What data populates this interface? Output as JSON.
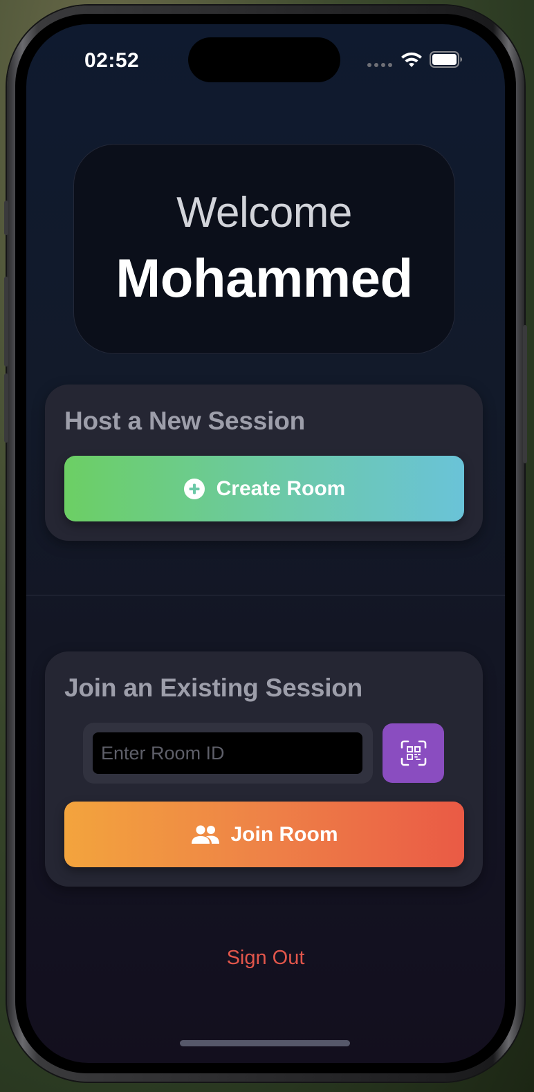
{
  "status_bar": {
    "time": "02:52",
    "icons": [
      "signal-dots-icon",
      "wifi-icon",
      "battery-icon"
    ]
  },
  "welcome": {
    "greeting": "Welcome",
    "name": "Mohammed"
  },
  "host_section": {
    "title": "Host a New Session",
    "create_button_label": "Create Room",
    "create_button_icon": "plus-circle-icon"
  },
  "join_section": {
    "title": "Join an Existing Session",
    "room_id_placeholder": "Enter Room ID",
    "room_id_value": "",
    "qr_button_icon": "qr-scan-icon",
    "join_button_label": "Join Room",
    "join_button_icon": "people-icon"
  },
  "sign_out_label": "Sign Out",
  "colors": {
    "create_gradient": [
      "#6ccf64",
      "#6ac3d8"
    ],
    "join_gradient": [
      "#f3a43d",
      "#ea5a45"
    ],
    "qr_button": "#8a4dc0",
    "sign_out": "#e2564b"
  }
}
